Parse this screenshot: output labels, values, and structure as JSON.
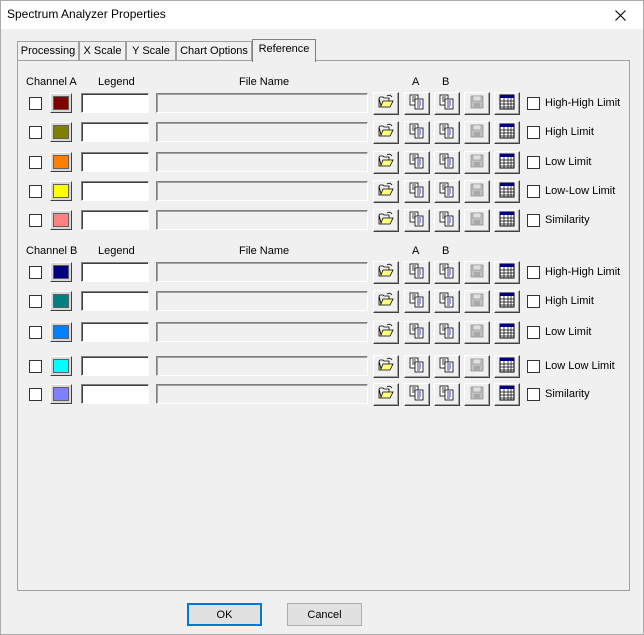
{
  "window": {
    "title": "Spectrum Analyzer Properties"
  },
  "tabs": [
    {
      "label": "Processing"
    },
    {
      "label": "X Scale"
    },
    {
      "label": "Y Scale"
    },
    {
      "label": "Chart Options"
    },
    {
      "label": "Reference",
      "active": true
    }
  ],
  "channel_a": {
    "title": "Channel A",
    "legend_header": "Legend",
    "file_header": "File Name",
    "col_a": "A",
    "col_b": "B",
    "rows": [
      {
        "color": "#800000",
        "legend": "",
        "file": "",
        "limit": "High-High Limit"
      },
      {
        "color": "#808000",
        "legend": "",
        "file": "",
        "limit": "High Limit"
      },
      {
        "color": "#ff8000",
        "legend": "",
        "file": "",
        "limit": "Low Limit"
      },
      {
        "color": "#ffff00",
        "legend": "",
        "file": "",
        "limit": "Low-Low Limit"
      },
      {
        "color": "#ff8080",
        "legend": "",
        "file": "",
        "limit": "Similarity"
      }
    ]
  },
  "channel_b": {
    "title": "Channel B",
    "legend_header": "Legend",
    "file_header": "File Name",
    "col_a": "A",
    "col_b": "B",
    "rows": [
      {
        "color": "#000080",
        "legend": "",
        "file": "",
        "limit": "High-High Limit"
      },
      {
        "color": "#008080",
        "legend": "",
        "file": "",
        "limit": "High Limit"
      },
      {
        "color": "#0080ff",
        "legend": "",
        "file": "",
        "limit": "Low Limit"
      },
      {
        "color": "#00ffff",
        "legend": "",
        "file": "",
        "limit": "Low Low Limit"
      },
      {
        "color": "#8080ff",
        "legend": "",
        "file": "",
        "limit": "Similarity"
      }
    ]
  },
  "buttons": {
    "ok": "OK",
    "cancel": "Cancel"
  },
  "icons": [
    "folder-open-icon",
    "copy-a-icon",
    "copy-b-icon",
    "save-icon",
    "table-grid-icon",
    "close-icon"
  ]
}
